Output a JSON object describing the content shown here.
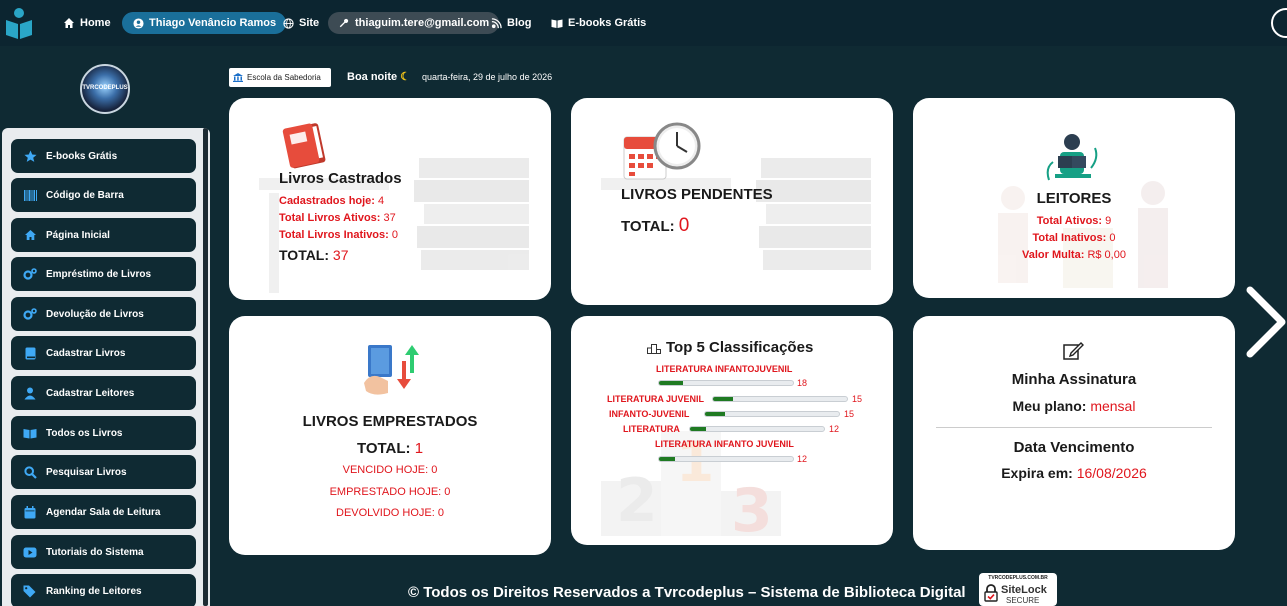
{
  "nav": {
    "home": "Home",
    "user": "Thiago Venâncio Ramos",
    "site": "Site",
    "email": "thiaguim.tere@gmail.com",
    "blog": "Blog",
    "ebooks": "E-books Grátis"
  },
  "logo_text": "TVRCODEPLUS",
  "sidebar": {
    "items": [
      {
        "label": "E-books Grátis",
        "icon": "star-icon"
      },
      {
        "label": "Código de Barra",
        "icon": "barcode-icon"
      },
      {
        "label": "Página Inicial",
        "icon": "home-icon"
      },
      {
        "label": "Empréstimo de Livros",
        "icon": "gears-icon"
      },
      {
        "label": "Devolução de Livros",
        "icon": "gears-icon"
      },
      {
        "label": "Cadastrar Livros",
        "icon": "book-icon"
      },
      {
        "label": "Cadastrar Leitores",
        "icon": "user-icon"
      },
      {
        "label": "Todos os Livros",
        "icon": "open-book-icon"
      },
      {
        "label": "Pesquisar Livros",
        "icon": "search-icon"
      },
      {
        "label": "Agendar Sala de Leitura",
        "icon": "calendar-icon"
      },
      {
        "label": "Tutoriais do Sistema",
        "icon": "youtube-icon"
      },
      {
        "label": "Ranking de Leitores",
        "icon": "tags-icon"
      }
    ]
  },
  "header": {
    "school": "Escola da Sabedoria",
    "greeting": "Boa noite",
    "date": "quarta-feira, 29 de julho de 2026"
  },
  "cards": {
    "castrados": {
      "title": "Livros Castrados",
      "hoje_label": "Cadastrados hoje:",
      "hoje_value": "4",
      "ativos_label": "Total Livros Ativos:",
      "ativos_value": "37",
      "inativos_label": "Total Livros Inativos:",
      "inativos_value": "0",
      "total_label": "TOTAL:",
      "total_value": "37"
    },
    "pendentes": {
      "title": "LIVROS PENDENTES",
      "total_label": "TOTAL:",
      "total_value": "0"
    },
    "leitores": {
      "title": "LEITORES",
      "ativos_label": "Total Ativos:",
      "ativos_value": "9",
      "inativos_label": "Total Inativos:",
      "inativos_value": "0",
      "multa_label": "Valor Multa:",
      "multa_value": "R$ 0,00"
    },
    "emprestados": {
      "title": "LIVROS EMPRESTADOS",
      "total_label": "TOTAL:",
      "total_value": "1",
      "vencido": "VENCIDO HOJE: 0",
      "emprestado": "EMPRESTADO HOJE: 0",
      "devolvido": "DEVOLVIDO HOJE: 0"
    },
    "top5": {
      "title": "Top 5 Classificações",
      "rows": [
        {
          "label": "LITERATURA INFANTOJUVENIL",
          "value": 18,
          "fraction": 0.18
        },
        {
          "label": "LITERATURA JUVENIL",
          "value": 15,
          "fraction": 0.15
        },
        {
          "label": "INFANTO-JUVENIL",
          "value": 15,
          "fraction": 0.15
        },
        {
          "label": "LITERATURA",
          "value": 12,
          "fraction": 0.12
        },
        {
          "label": "LITERATURA INFANTO JUVENIL",
          "value": 12,
          "fraction": 0.12
        }
      ]
    },
    "assinatura": {
      "title": "Minha Assinatura",
      "plano_label": "Meu plano:",
      "plano_value": "mensal",
      "venc_title": "Data Vencimento",
      "expira_label": "Expira em:",
      "expira_value": "16/08/2026"
    }
  },
  "footer": "© Todos os Direitos Reservados a Tvrcodeplus – Sistema de Biblioteca Digital",
  "sitelock": {
    "top": "TVRCODEPLUS.COM.BR",
    "brand": "SiteLock",
    "secure": "SECURE"
  },
  "colors": {
    "background": "#0f2a33",
    "accent": "#e0161d",
    "pill": "#1a6f9a",
    "progress": "#1f7a22"
  }
}
